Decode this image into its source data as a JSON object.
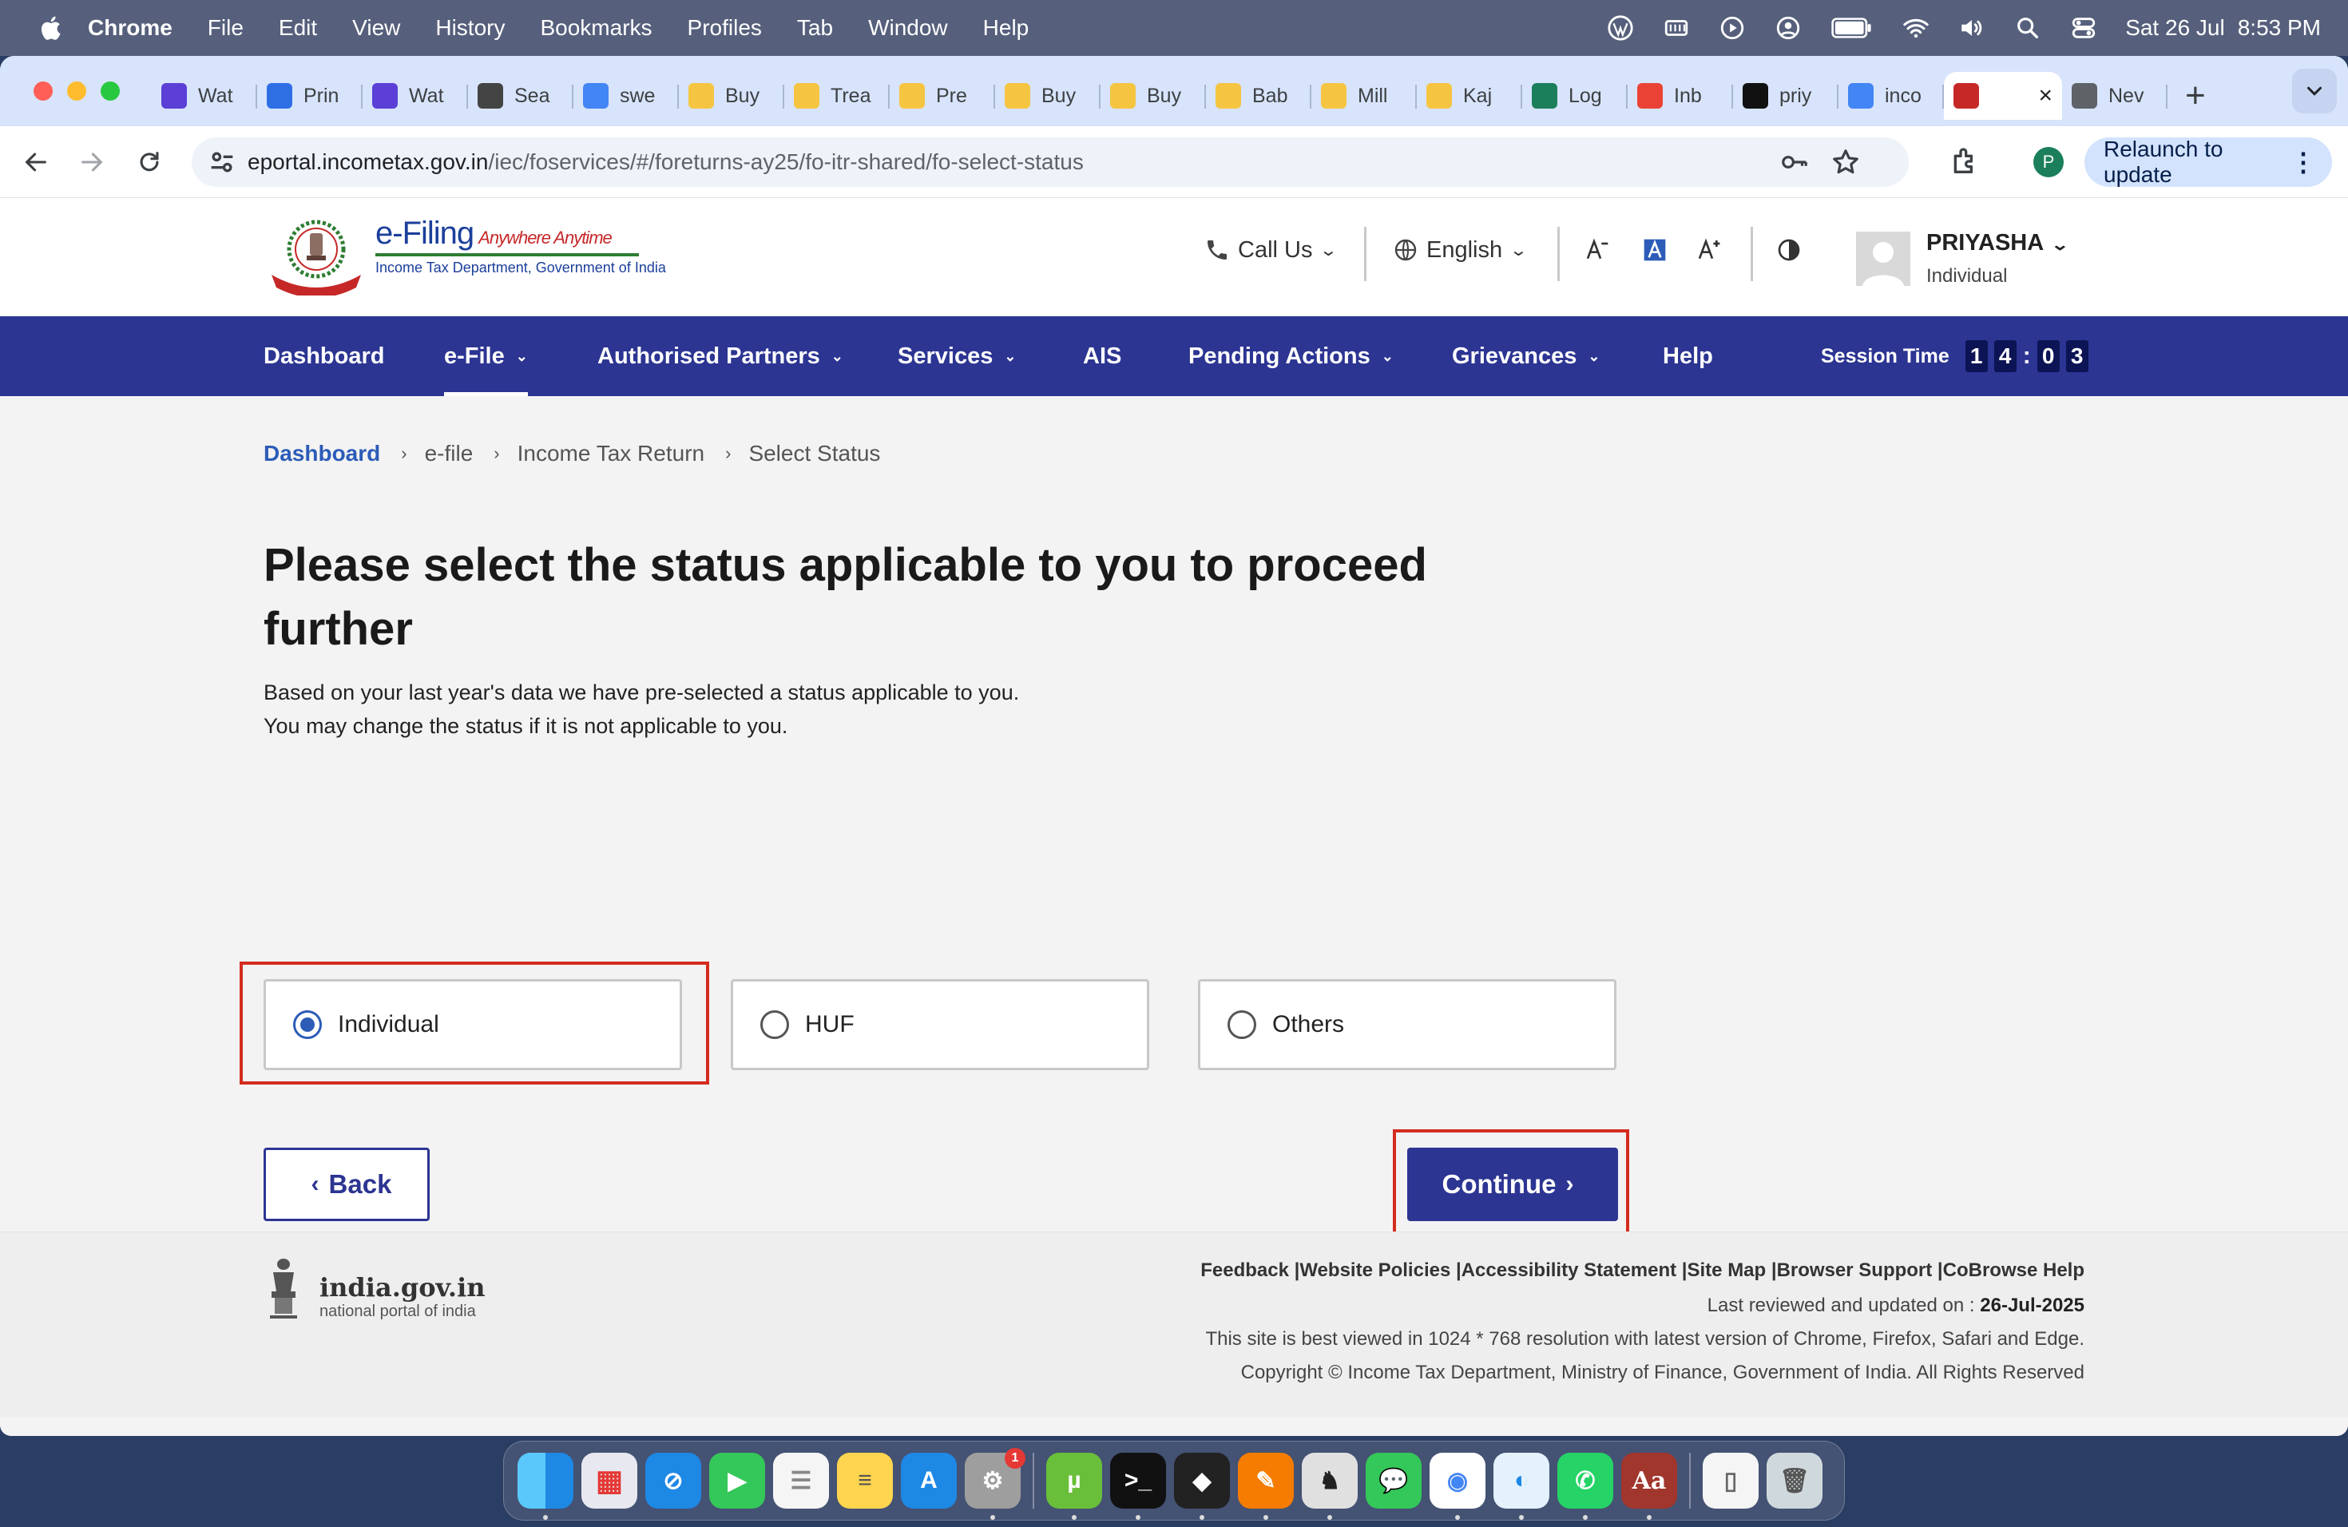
{
  "menubar": {
    "items": [
      "Chrome",
      "File",
      "Edit",
      "View",
      "History",
      "Bookmarks",
      "Profiles",
      "Tab",
      "Window",
      "Help"
    ],
    "date": "Sat 26 Jul",
    "time": "8:53 PM"
  },
  "browser": {
    "tabs": [
      {
        "label": "Wat",
        "icon": "sparkle-icon",
        "color": "#5b3fd6"
      },
      {
        "label": "Prin",
        "icon": "play-circle-icon",
        "color": "#2f6fe4"
      },
      {
        "label": "Wat",
        "icon": "sparkle-icon",
        "color": "#5b3fd6"
      },
      {
        "label": "Sea",
        "icon": "tower-icon",
        "color": "#444444"
      },
      {
        "label": "swe",
        "icon": "google-icon",
        "color": "#4285f4"
      },
      {
        "label": "Buy",
        "icon": "coin-icon",
        "color": "#f5c542"
      },
      {
        "label": "Trea",
        "icon": "coin-icon",
        "color": "#f5c542"
      },
      {
        "label": "Pre",
        "icon": "coin-icon",
        "color": "#f5c542"
      },
      {
        "label": "Buy",
        "icon": "coin-icon",
        "color": "#f5c542"
      },
      {
        "label": "Buy",
        "icon": "coin-icon",
        "color": "#f5c542"
      },
      {
        "label": "Bab",
        "icon": "coin-icon",
        "color": "#f5c542"
      },
      {
        "label": "Mill",
        "icon": "coin-icon",
        "color": "#f5c542"
      },
      {
        "label": "Kaj",
        "icon": "coin-icon",
        "color": "#f5c542"
      },
      {
        "label": "Log",
        "icon": "leaf-icon",
        "color": "#1b7f5b"
      },
      {
        "label": "Inb",
        "icon": "gmail-icon",
        "color": "#ea4335"
      },
      {
        "label": "priy",
        "icon": "github-icon",
        "color": "#111111"
      },
      {
        "label": "inco",
        "icon": "google-icon",
        "color": "#4285f4"
      },
      {
        "label": "",
        "icon": "emblem-icon",
        "color": "#c62828",
        "active": true
      },
      {
        "label": "Nev",
        "icon": "chrome-icon",
        "color": "#5f6368"
      }
    ],
    "url_host": "eportal.incometax.gov.in",
    "url_path": "/iec/foservices/#/foreturns-ay25/fo-itr-shared/fo-select-status",
    "profile_initial": "P",
    "relaunch_label": "Relaunch to update"
  },
  "header": {
    "logo_title": "e-Filing",
    "logo_tagline": "Anywhere Anytime",
    "logo_subtitle": "Income Tax Department, Government of India",
    "call_us": "Call Us",
    "language": "English",
    "user_name": "PRIYASHA",
    "user_role": "Individual"
  },
  "nav": {
    "items": [
      "Dashboard",
      "e-File",
      "Authorised Partners",
      "Services",
      "AIS",
      "Pending Actions",
      "Grievances",
      "Help"
    ],
    "session_label": "Session Time",
    "session_digits": [
      "1",
      "4",
      "0",
      "3"
    ]
  },
  "breadcrumb": [
    "Dashboard",
    "e-file",
    "Income Tax Return",
    "Select Status"
  ],
  "main": {
    "title": "Please select the status applicable to you to proceed further",
    "desc1": "Based on your last year's data we have pre-selected a status applicable to you.",
    "desc2": "You may change the status if it is not applicable to you.",
    "options": [
      "Individual",
      "HUF",
      "Others"
    ],
    "selected": "Individual",
    "back_label": "Back",
    "continue_label": "Continue",
    "highlight_color": "#d42c1f"
  },
  "footer": {
    "portal_name": "india.gov.in",
    "portal_sub": "national portal of india",
    "links": "Feedback |Website Policies |Accessibility Statement |Site Map |Browser Support |CoBrowse Help",
    "updated_label": "Last reviewed and updated on :",
    "updated_date": "26-Jul-2025",
    "best_viewed": "This site is best viewed in 1024 * 768 resolution with latest version of Chrome, Firefox, Safari and Edge.",
    "copyright": "Copyright © Income Tax Department, Ministry of Finance, Government of India. All Rights Reserved"
  },
  "colors": {
    "nav_bg": "#2c3592",
    "accent_blue": "#2c5cb8"
  }
}
